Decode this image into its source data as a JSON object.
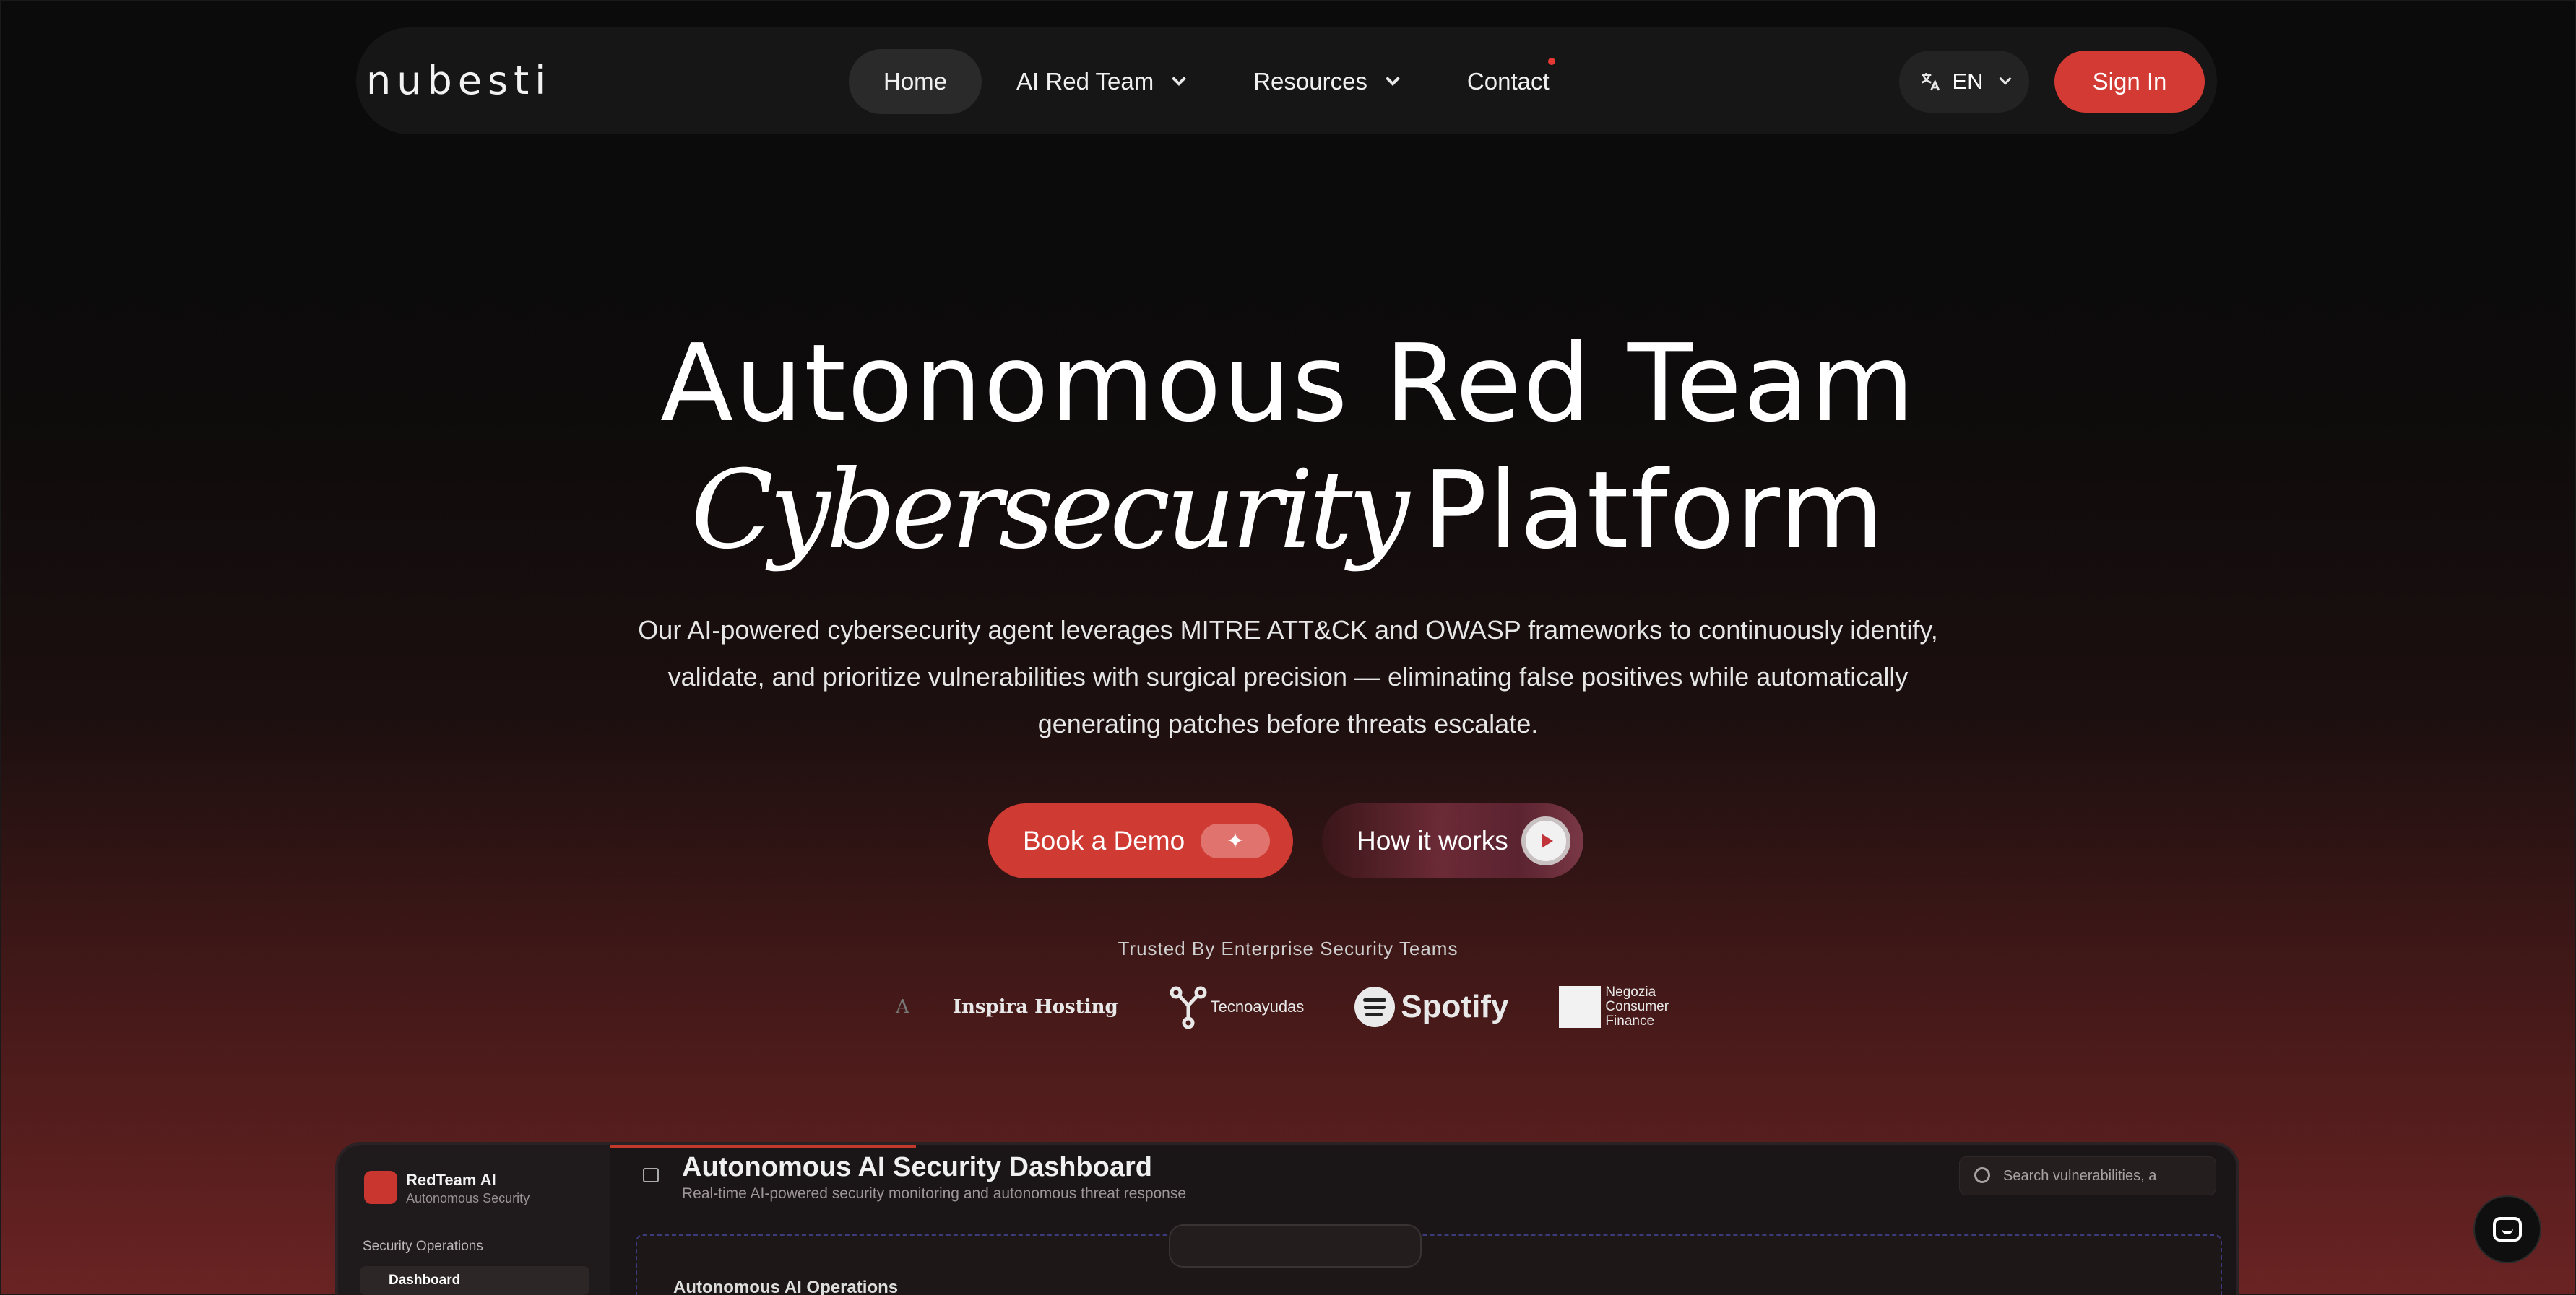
{
  "nav": {
    "logo": "nubesti",
    "links": [
      {
        "label": "Home",
        "active": true
      },
      {
        "label": "AI Red Team",
        "dropdown": true
      },
      {
        "label": "Resources",
        "dropdown": true
      },
      {
        "label": "Contact",
        "notification_dot": true
      }
    ],
    "language": "EN",
    "sign_in": "Sign In",
    "accent_color": "#d23a33"
  },
  "hero": {
    "title_line1": "Autonomous Red Team",
    "title_line2_italic": "Cybersecurity",
    "title_line2_rest": "Platform",
    "subtitle_line1": "Our AI-powered cybersecurity agent leverages MITRE ATT&CK and OWASP frameworks to continuously identify,",
    "subtitle_line2": "validate, and prioritize vulnerabilities with surgical precision — eliminating false positives while automatically",
    "subtitle_line3": "generating patches before threats escalate.",
    "cta_primary": "Book a Demo",
    "cta_secondary": "How it works"
  },
  "trusted": {
    "label": "Trusted By Enterprise Security Teams",
    "logos": {
      "faded": "A",
      "inspira": "Inspira Hosting",
      "tecno": "Tecnoayudas",
      "spotify": "Spotify",
      "negozia_1": "Negozia",
      "negozia_2": "Consumer",
      "negozia_3": "Finance"
    }
  },
  "dashboard": {
    "brand": "RedTeam AI",
    "brand_sub": "Autonomous Security",
    "section": "Security Operations",
    "nav_item": "Dashboard",
    "title": "Autonomous AI Security Dashboard",
    "subtitle": "Real-time AI-powered security monitoring and autonomous threat response",
    "search_placeholder": "Search vulnerabilities, a",
    "panel_title": "Autonomous AI Operations"
  }
}
